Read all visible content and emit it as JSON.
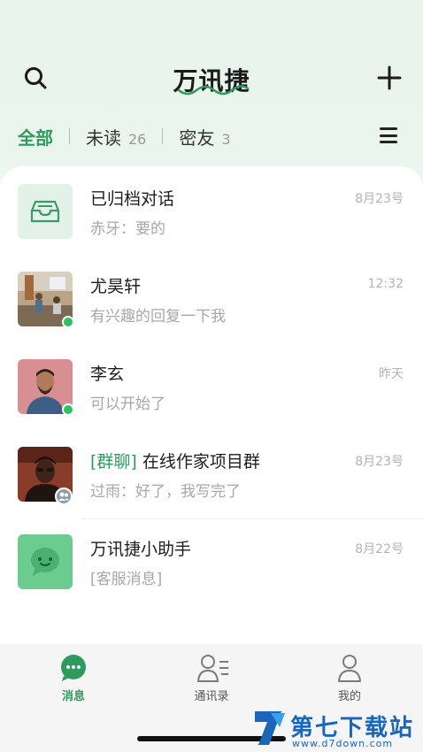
{
  "header": {
    "title": "万讯捷",
    "tabs": [
      {
        "label": "全部",
        "count": ""
      },
      {
        "label": "未读",
        "count": "26"
      },
      {
        "label": "密友",
        "count": "3"
      }
    ]
  },
  "conversations": [
    {
      "name": "已归档对话",
      "tag": "",
      "message": "赤牙：要的",
      "time": "8月23号"
    },
    {
      "name": "尤昊轩",
      "tag": "",
      "message": "有兴趣的回复一下我",
      "time": "12:32"
    },
    {
      "name": "李玄",
      "tag": "",
      "message": "可以开始了",
      "time": "昨天"
    },
    {
      "name": "在线作家项目群",
      "tag": "[群聊]",
      "message": "过雨：好了，我写完了",
      "time": "8月23号"
    },
    {
      "name": "万讯捷小助手",
      "tag": "",
      "message": "[客服消息]",
      "time": "8月22号"
    }
  ],
  "nav": [
    {
      "label": "消息"
    },
    {
      "label": "通讯录"
    },
    {
      "label": "我的"
    }
  ],
  "watermark": {
    "main": "第七下载站",
    "sub": "www.d7down.com"
  },
  "colors": {
    "accent": "#2f9a5e",
    "online": "#2cc25e",
    "brand_blue": "#1b66b8"
  }
}
